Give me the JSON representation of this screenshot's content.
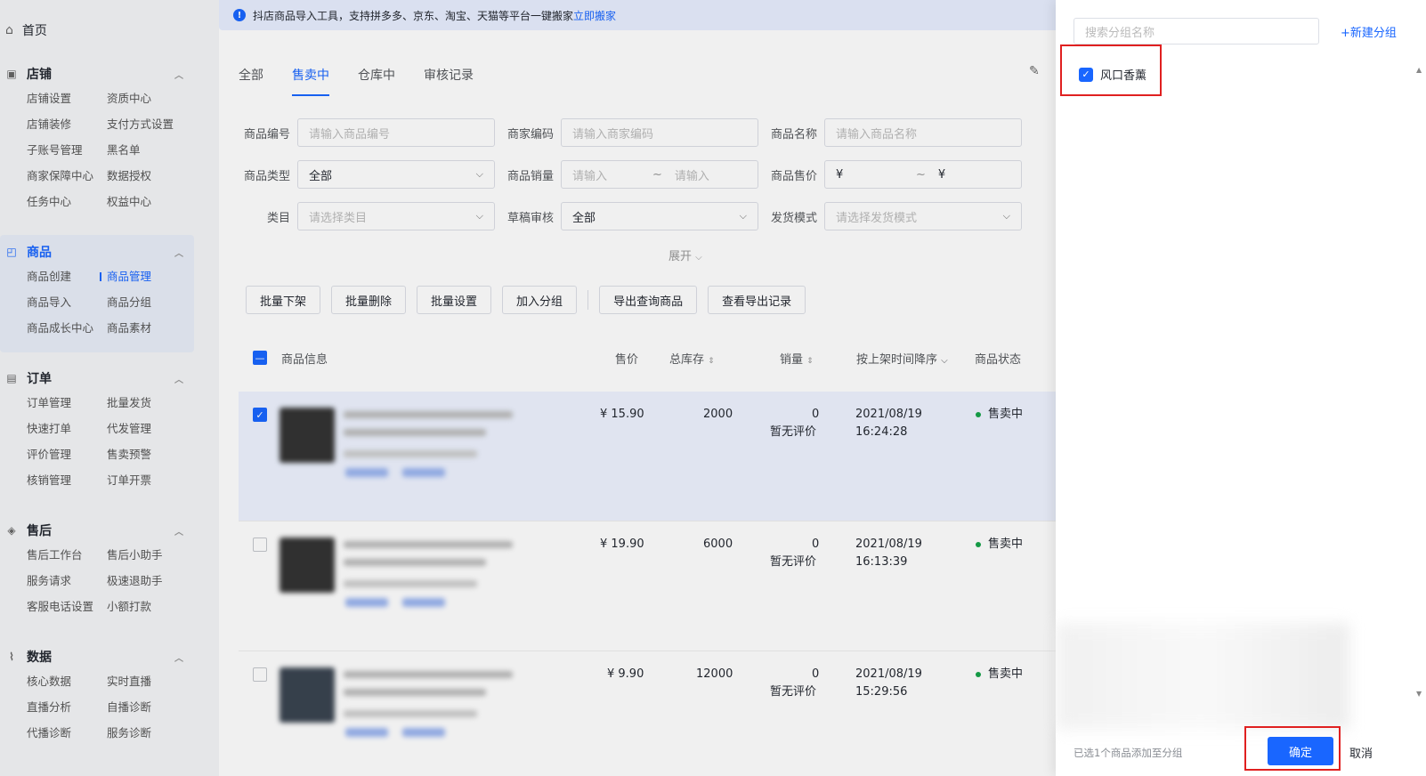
{
  "sidebar": {
    "home": "首页",
    "sections": [
      {
        "title": "店铺",
        "items": [
          "店铺设置",
          "资质中心",
          "店铺装修",
          "支付方式设置",
          "子账号管理",
          "黑名单",
          "商家保障中心",
          "数据授权",
          "任务中心",
          "权益中心"
        ]
      },
      {
        "title": "商品",
        "items": [
          "商品创建",
          "商品管理",
          "商品导入",
          "商品分组",
          "商品成长中心",
          "商品素材"
        ]
      },
      {
        "title": "订单",
        "items": [
          "订单管理",
          "批量发货",
          "快速打单",
          "代发管理",
          "评价管理",
          "售卖预警",
          "核销管理",
          "订单开票"
        ]
      },
      {
        "title": "售后",
        "items": [
          "售后工作台",
          "售后小助手",
          "服务请求",
          "极速退助手",
          "客服电话设置",
          "小额打款"
        ]
      },
      {
        "title": "数据",
        "items": [
          "核心数据",
          "实时直播",
          "直播分析",
          "自播诊断",
          "代播诊断",
          "服务诊断"
        ]
      }
    ]
  },
  "notice": {
    "text": "抖店商品导入工具，支持拼多多、京东、淘宝、天猫等平台一键搬家",
    "link": "立即搬家"
  },
  "tabs": [
    "全部",
    "售卖中",
    "仓库中",
    "审核记录"
  ],
  "filters": {
    "product_id": {
      "label": "商品编号",
      "placeholder": "请输入商品编号"
    },
    "merchant_code": {
      "label": "商家编码",
      "placeholder": "请输入商家编码"
    },
    "product_name": {
      "label": "商品名称",
      "placeholder": "请输入商品名称"
    },
    "product_type": {
      "label": "商品类型",
      "value": "全部"
    },
    "sales": {
      "label": "商品销量",
      "from": "请输入",
      "sep": "~",
      "to": "请输入"
    },
    "price": {
      "label": "商品售价",
      "from": "¥",
      "sep": "~",
      "to": "¥"
    },
    "category": {
      "label": "类目",
      "placeholder": "请选择类目"
    },
    "draft_review": {
      "label": "草稿审核",
      "value": "全部"
    },
    "ship_mode": {
      "label": "发货模式",
      "placeholder": "请选择发货模式"
    },
    "expand": "展开"
  },
  "actions": [
    "批量下架",
    "批量删除",
    "批量设置",
    "加入分组",
    "导出查询商品",
    "查看导出记录"
  ],
  "table": {
    "headers": {
      "info": "商品信息",
      "price": "售价",
      "stock": "总库存",
      "sales": "销量",
      "time": "按上架时间降序",
      "status": "商品状态"
    },
    "rows": [
      {
        "price": "¥ 15.90",
        "stock": "2000",
        "sales": "0",
        "review": "暂无评价",
        "date": "2021/08/19",
        "time": "16:24:28",
        "status": "售卖中",
        "checked": true
      },
      {
        "price": "¥ 19.90",
        "stock": "6000",
        "sales": "0",
        "review": "暂无评价",
        "date": "2021/08/19",
        "time": "16:13:39",
        "status": "售卖中",
        "checked": false
      },
      {
        "price": "¥ 9.90",
        "stock": "12000",
        "sales": "0",
        "review": "暂无评价",
        "date": "2021/08/19",
        "time": "15:29:56",
        "status": "售卖中",
        "checked": false
      }
    ]
  },
  "drawer": {
    "search_placeholder": "搜索分组名称",
    "new_group": "+新建分组",
    "group_item": "风口香薰",
    "footer_note": "已选1个商品添加至分组",
    "confirm": "确定",
    "cancel": "取消"
  },
  "colors": {
    "accent": "#1966ff",
    "highlight_box": "#e02020",
    "status_dot": "#16a34a"
  }
}
